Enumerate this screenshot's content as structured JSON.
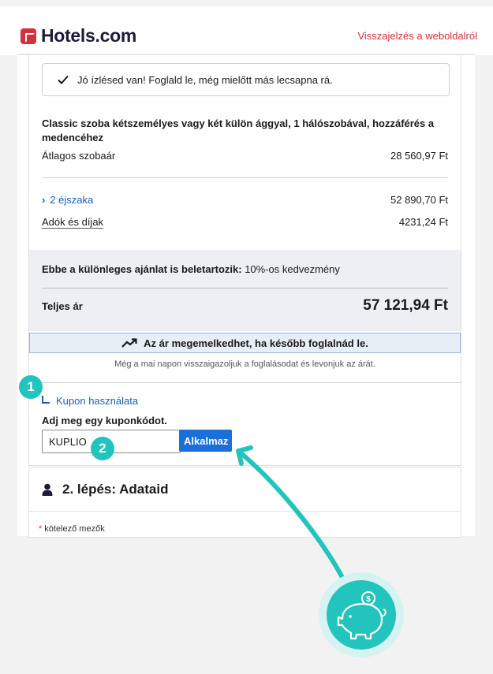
{
  "header": {
    "logo_text": "Hotels.com",
    "feedback_link": "Visszajelzés a weboldalról"
  },
  "notice": {
    "text": "Jó ízlésed van! Foglald le, még mielőtt más lecsapna rá."
  },
  "room": {
    "title": "Classic szoba kétszemélyes vagy két külön ággyal, 1 hálószobával, hozzáférés a medencéhez",
    "avg_label": "Átlagos szobaár",
    "avg_value": "28 560,97 Ft",
    "nights_label": "2 éjszaka",
    "nights_value": "52 890,70 Ft",
    "taxes_label": "Adók és díjak",
    "taxes_value": "4231,24 Ft"
  },
  "summary": {
    "offer_label": "Ebbe a különleges ajánlat is beletartozik:",
    "offer_value": "10%-os kedvezmény",
    "total_label": "Teljes ár",
    "total_value": "57 121,94 Ft"
  },
  "banner": {
    "price_warning": "Az ár megemelkedhet, ha később foglalnád le.",
    "confirm_text": "Még a mai napon visszaigazoljuk a foglalásodat és levonjuk az árát."
  },
  "coupon": {
    "toggle_label": "Kupon használata",
    "field_label": "Adj meg egy kuponkódot.",
    "input_value": "KUPLIO",
    "apply_label": "Alkalmaz"
  },
  "step2": {
    "title": "2. lépés: Adataid",
    "required_note": "kötelező mezők",
    "required_star": "*"
  },
  "badges": {
    "one": "1",
    "two": "2"
  },
  "colors": {
    "brand_red": "#d32f3c",
    "link_blue": "#1a5fb4",
    "button_blue": "#1a6fd8",
    "teal_accent": "#22c4bd",
    "summary_bg": "#eeeff2"
  },
  "icons": {
    "notice": "check-icon",
    "banner": "trending-up-icon",
    "step2": "person-icon",
    "promo": "piggy-bank-coin-icon",
    "nights": "chevron-right-icon"
  }
}
